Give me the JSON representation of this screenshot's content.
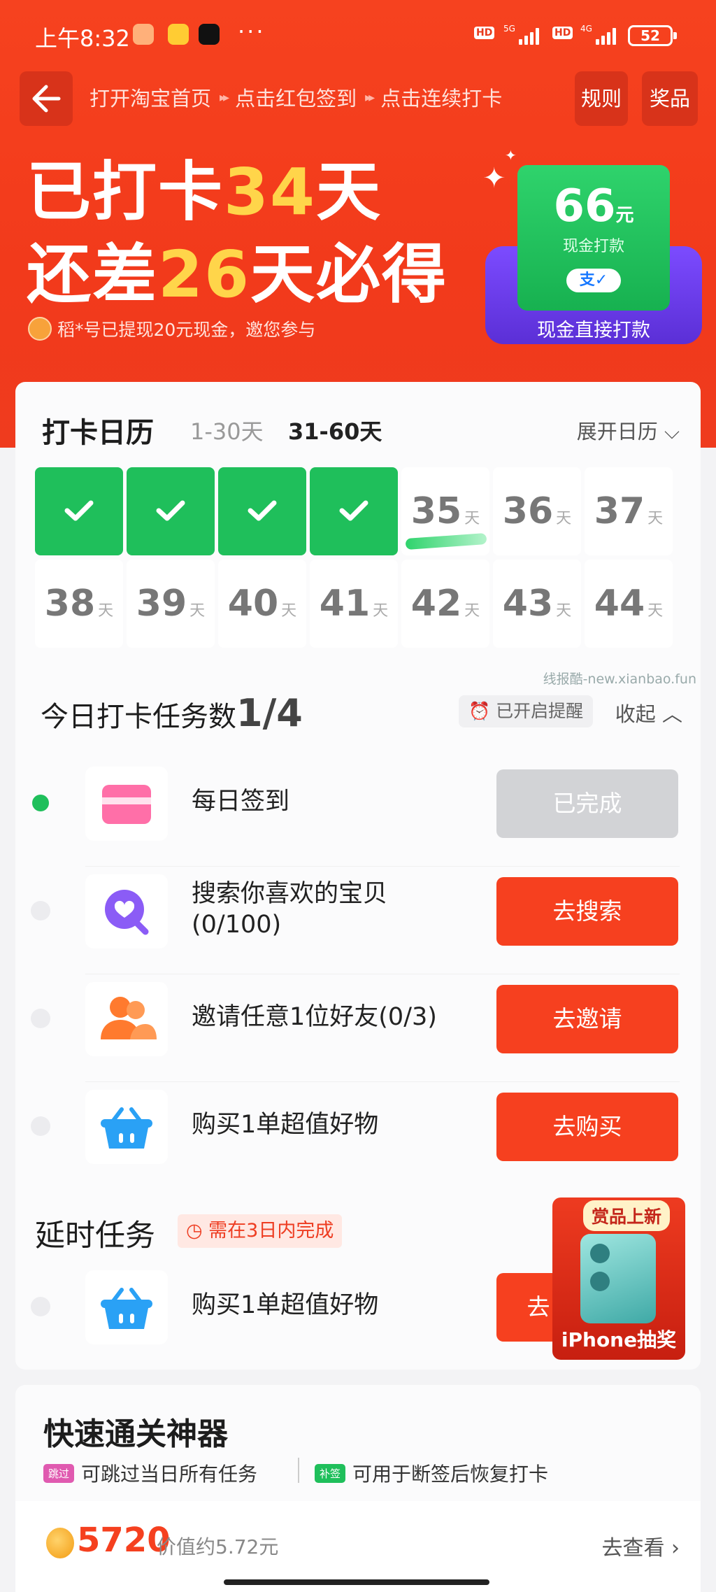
{
  "status_bar": {
    "time": "上午8:32",
    "hd": "HD",
    "net1": "5G",
    "net2": "4G",
    "battery": "52"
  },
  "nav": {
    "steps": [
      "打开淘宝首页",
      "点击红包签到",
      "点击连续打卡"
    ],
    "arrow": "▸▸",
    "rules_label": "规则",
    "prize_label": "奖品"
  },
  "hero": {
    "line1_prefix": "已打卡",
    "line1_num": "34",
    "line1_suffix": "天",
    "line2_prefix": "还差",
    "line2_num": "26",
    "line2_suffix": "天必得",
    "note": "稻*号已提现20元现金，邀您参与",
    "cash_amount": "66",
    "cash_unit": "元",
    "cash_label": "现金打款",
    "pay_logo": "支✓",
    "cash_caption": "现金直接打款"
  },
  "calendar": {
    "title": "打卡日历",
    "range1": "1-30天",
    "range2": "31-60天",
    "expand_label": "展开日历",
    "day_unit": "天",
    "days": [
      "35",
      "36",
      "37",
      "38",
      "39",
      "40",
      "41",
      "42",
      "43",
      "44"
    ],
    "watermark": "线报酷-new.xianbao.fun"
  },
  "tasks": {
    "title": "今日打卡任务数",
    "count": "1/4",
    "remind_label": "已开启提醒",
    "fold_label": "收起",
    "items": [
      {
        "label": "每日签到",
        "button": "已完成"
      },
      {
        "label": "搜索你喜欢的宝贝",
        "label2": "(0/100)",
        "button": "去搜索"
      },
      {
        "label": "邀请任意1位好友(0/3)",
        "button": "去邀请"
      },
      {
        "label": "购买1单超值好物",
        "button": "去购买"
      }
    ]
  },
  "delayed": {
    "title": "延时任务",
    "tag": "需在3日内完成",
    "item_label": "购买1单超值好物",
    "button": "去"
  },
  "promo": {
    "tag": "赏品上新",
    "caption": "iPhone抽奖"
  },
  "quick": {
    "title": "快速通关神器",
    "feature1_chip": "跳过",
    "feature1": "可跳过当日所有任务",
    "feature2_chip": "补签",
    "feature2": "可用于断签后恢复打卡",
    "coins": "5720",
    "coins_note": "价值约5.72元",
    "go_view": "去查看"
  }
}
